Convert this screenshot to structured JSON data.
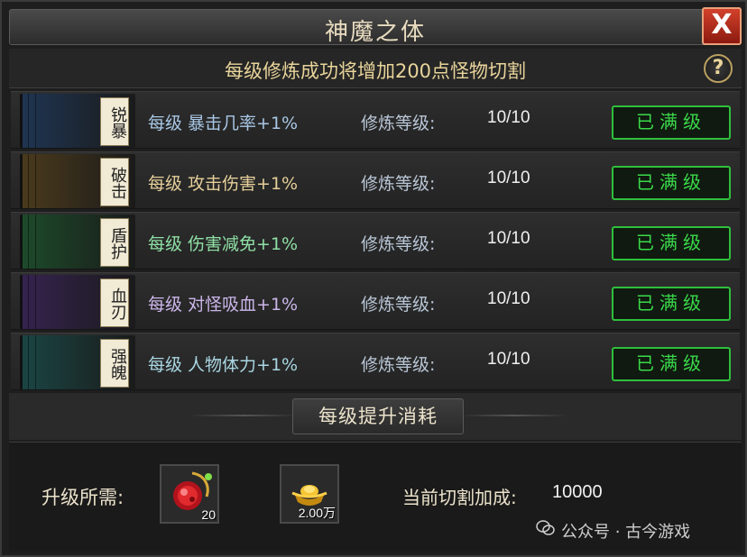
{
  "window": {
    "title": "神魔之体",
    "close_label": "X",
    "subtitle": "每级修炼成功将增加200点怪物切割",
    "help_label": "?"
  },
  "skills": [
    {
      "tag": "锐暴",
      "effect": "每级 暴击几率+1%",
      "level_label": "修炼等级:",
      "level": "10/10",
      "status": "已满级",
      "book_color": "#1f3552",
      "effect_color": "#a9c7e6"
    },
    {
      "tag": "破击",
      "effect": "每级 攻击伤害+1%",
      "level_label": "修炼等级:",
      "level": "10/10",
      "status": "已满级",
      "book_color": "#4a3a1c",
      "effect_color": "#e6cf9a"
    },
    {
      "tag": "盾护",
      "effect": "每级 伤害减免+1%",
      "level_label": "修炼等级:",
      "level": "10/10",
      "status": "已满级",
      "book_color": "#1d4a2a",
      "effect_color": "#8fe0a5"
    },
    {
      "tag": "血刃",
      "effect": "每级 对怪吸血+1%",
      "level_label": "修炼等级:",
      "level": "10/10",
      "status": "已满级",
      "book_color": "#35234f",
      "effect_color": "#cbb6ea"
    },
    {
      "tag": "强魄",
      "effect": "每级 人物体力+1%",
      "level_label": "修炼等级:",
      "level": "10/10",
      "status": "已满级",
      "book_color": "#1a4543",
      "effect_color": "#a9d6e2"
    }
  ],
  "cost": {
    "tab_label": "每级提升消耗",
    "requirement_label": "升级所需:",
    "items": [
      {
        "icon": "red-gem-icon",
        "qty": "20"
      },
      {
        "icon": "gold-ingot-icon",
        "qty": "2.00万"
      }
    ],
    "current_label": "当前切割加成:",
    "current_value": "10000"
  },
  "watermark": "公众号 · 古今游戏"
}
